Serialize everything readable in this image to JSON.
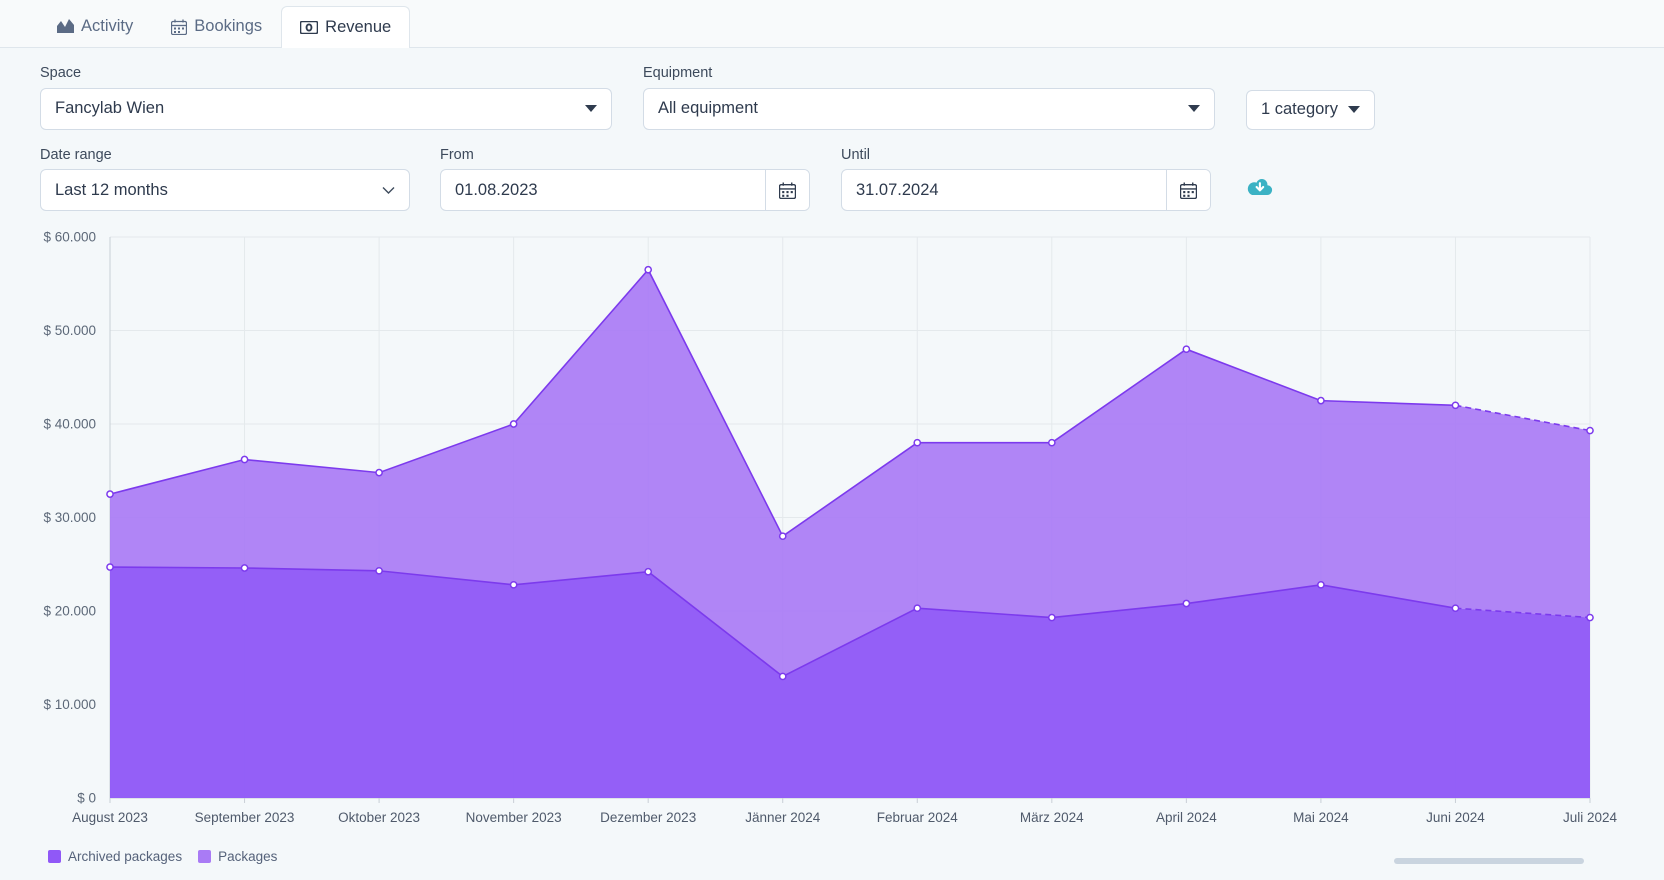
{
  "tabs": [
    {
      "label": "Activity",
      "icon": "area-chart-icon",
      "active": false
    },
    {
      "label": "Bookings",
      "icon": "calendar-icon",
      "active": false
    },
    {
      "label": "Revenue",
      "icon": "money-icon",
      "active": true
    }
  ],
  "filters": {
    "space": {
      "label": "Space",
      "value": "Fancylab Wien"
    },
    "equipment": {
      "label": "Equipment",
      "value": "All equipment"
    },
    "category": {
      "value": "1 category"
    },
    "date_range": {
      "label": "Date range",
      "value": "Last 12 months"
    },
    "from": {
      "label": "From",
      "value": "01.08.2023"
    },
    "until": {
      "label": "Until",
      "value": "31.07.2024"
    },
    "download": {
      "title": "Download"
    }
  },
  "colors": {
    "packages": "#a97bf5",
    "archived_packages": "#9058f7",
    "line_stroke": "#7c3aed",
    "download_icon": "#3bb2c4",
    "accent": "#9058f7"
  },
  "chart_data": {
    "type": "area",
    "stacked": true,
    "title": "",
    "xlabel": "",
    "ylabel": "",
    "grid": true,
    "legend_position": "bottom-left",
    "ylim": [
      0,
      60000
    ],
    "ytick_labels": [
      "$ 60.000",
      "$ 50.000",
      "$ 40.000",
      "$ 30.000",
      "$ 20.000",
      "$ 10.000",
      "$ 0"
    ],
    "ytick_values": [
      60000,
      50000,
      40000,
      30000,
      20000,
      10000,
      0
    ],
    "categories": [
      "August 2023",
      "September 2023",
      "Oktober 2023",
      "November 2023",
      "Dezember 2023",
      "Jänner 2024",
      "Februar 2024",
      "März 2024",
      "April 2024",
      "Mai 2024",
      "Juni 2024",
      "Juli 2024"
    ],
    "series": [
      {
        "name": "Archived packages",
        "color": "#9058f7",
        "values": [
          24700,
          24600,
          24300,
          22800,
          24200,
          13000,
          20300,
          19300,
          20800,
          22800,
          20300,
          19300
        ]
      },
      {
        "name": "Packages",
        "color": "#a97bf5",
        "values": [
          7800,
          11600,
          10500,
          17200,
          32300,
          15000,
          17700,
          18700,
          27200,
          19700,
          21700,
          20000
        ]
      }
    ],
    "cumulative_totals": [
      32500,
      36200,
      34800,
      40000,
      56500,
      28000,
      38000,
      38000,
      48000,
      42500,
      42000,
      39300
    ],
    "projected_from": "Juni 2024",
    "projected_note": "last segment drawn dashed"
  }
}
